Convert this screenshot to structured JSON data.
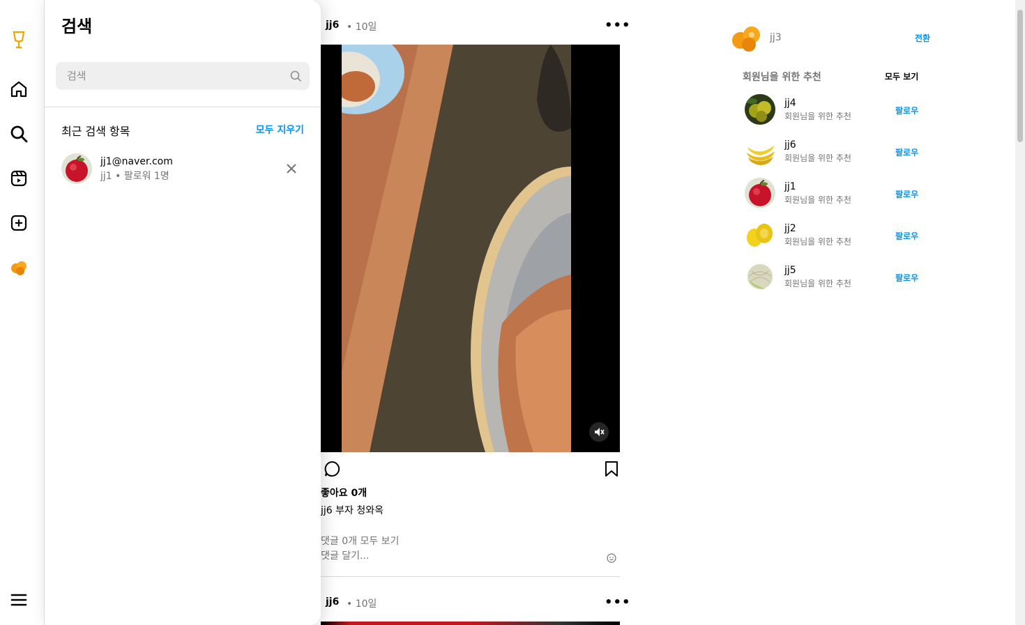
{
  "search_panel": {
    "title": "검색",
    "search_placeholder": "검색",
    "recent_title": "최근 검색 항목",
    "clear_all": "모두 지우기",
    "recent": [
      {
        "name": "jj1@naver.com",
        "sub": "jj1 • 팔로워 1명",
        "avatar": "apple"
      }
    ]
  },
  "nav": {
    "items": [
      "logo-icon",
      "home-icon",
      "search-icon",
      "reels-icon",
      "create-icon",
      "profile-avatar",
      "menu-icon"
    ]
  },
  "feed": {
    "posts": [
      {
        "user": "jj6",
        "time": "• 10일",
        "likes": "좋아요 0개",
        "caption": "jj6 부자 청와옥",
        "comments_link": "댓글 0개 모두 보기",
        "comment_placeholder": "댓글 달기..."
      },
      {
        "user": "jj6",
        "time": "• 10일"
      }
    ]
  },
  "sidebar_right": {
    "current_user": "jj3",
    "switch_label": "전환",
    "suggest_title": "회원님을 위한 추천",
    "see_all": "모두 보기",
    "suggestions": [
      {
        "name": "jj4",
        "sub": "회원님을 위한 추천",
        "follow": "팔로우",
        "avatar": "citrus"
      },
      {
        "name": "jj6",
        "sub": "회원님을 위한 추천",
        "follow": "팔로우",
        "avatar": "banana"
      },
      {
        "name": "jj1",
        "sub": "회원님을 위한 추천",
        "follow": "팔로우",
        "avatar": "apple"
      },
      {
        "name": "jj2",
        "sub": "회원님을 위한 추천",
        "follow": "팔로우",
        "avatar": "lemon"
      },
      {
        "name": "jj5",
        "sub": "회원님을 위한 추천",
        "follow": "팔로우",
        "avatar": "melon"
      }
    ]
  },
  "colors": {
    "accent": "#0095f6",
    "logo": "#f0a500"
  }
}
